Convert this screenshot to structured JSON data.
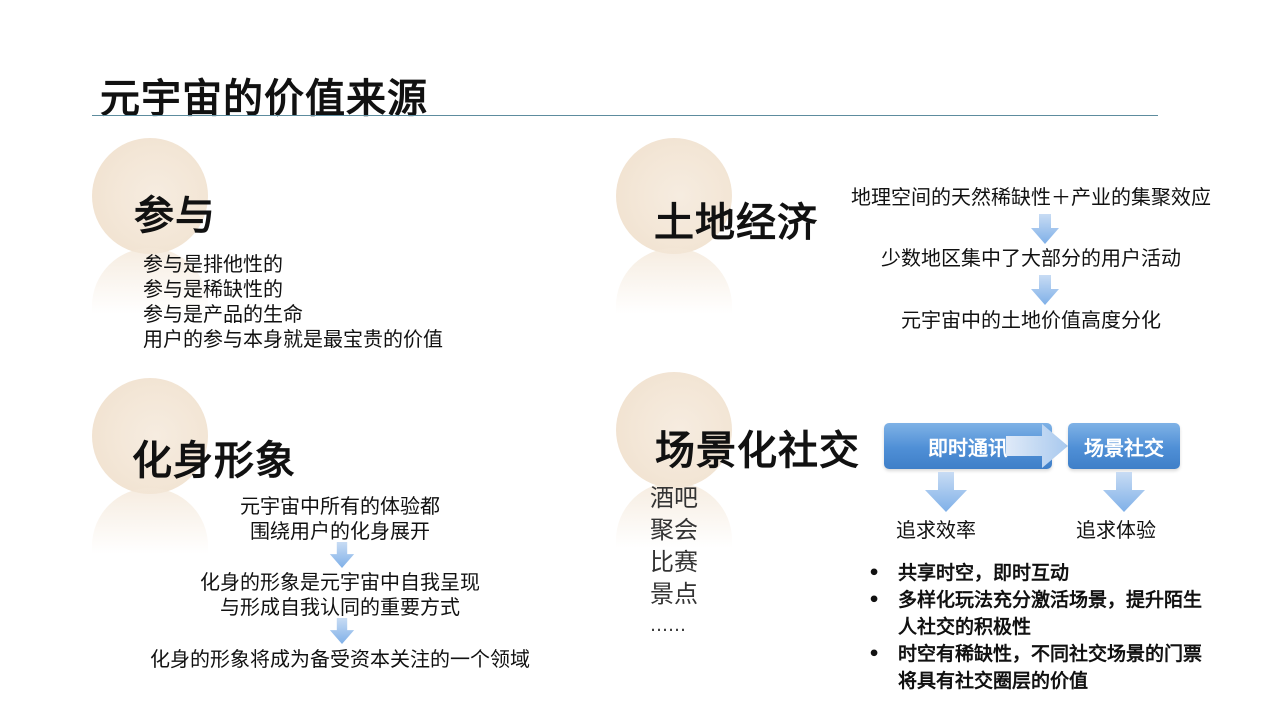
{
  "page": {
    "title": "元宇宙的价值来源"
  },
  "participation": {
    "heading": "参与",
    "lines": [
      "参与是排他性的",
      "参与是稀缺性的",
      "参与是产品的生命",
      "用户的参与本身就是最宝贵的价值"
    ]
  },
  "land_economy": {
    "heading": "土地经济",
    "steps": [
      "地理空间的天然稀缺性＋产业的集聚效应",
      "少数地区集中了大部分的用户活动",
      "元宇宙中的土地价值高度分化"
    ]
  },
  "avatar": {
    "heading": "化身形象",
    "steps": [
      [
        "元宇宙中所有的体验都",
        "围绕用户的化身展开"
      ],
      [
        "化身的形象是元宇宙中自我呈现",
        "与形成自我认同的重要方式"
      ],
      [
        "化身的形象将成为备受资本关注的一个领域"
      ]
    ]
  },
  "scene_social": {
    "heading": "场景化社交",
    "venues": [
      "酒吧",
      "聚会",
      "比赛",
      "景点",
      "……"
    ],
    "flow": {
      "left_box": "即时通讯",
      "right_box": "场景社交",
      "left_result": "追求效率",
      "right_result": "追求体验"
    },
    "bullets": [
      "共享时空，即时互动",
      "多样化玩法充分激活场景，提升陌生人社交的积极性",
      "时空有稀缺性，不同社交场景的门票将具有社交圈层的价值"
    ]
  },
  "colors": {
    "accent_blue": "#4f8fd6",
    "arrow_blue": "#9cc3ee",
    "circle_beige": "#f3e6d6",
    "rule": "#5d8c9e"
  },
  "icons": {
    "flow_arrow": "arrow-down-icon",
    "flow_right": "arrow-right-icon"
  }
}
